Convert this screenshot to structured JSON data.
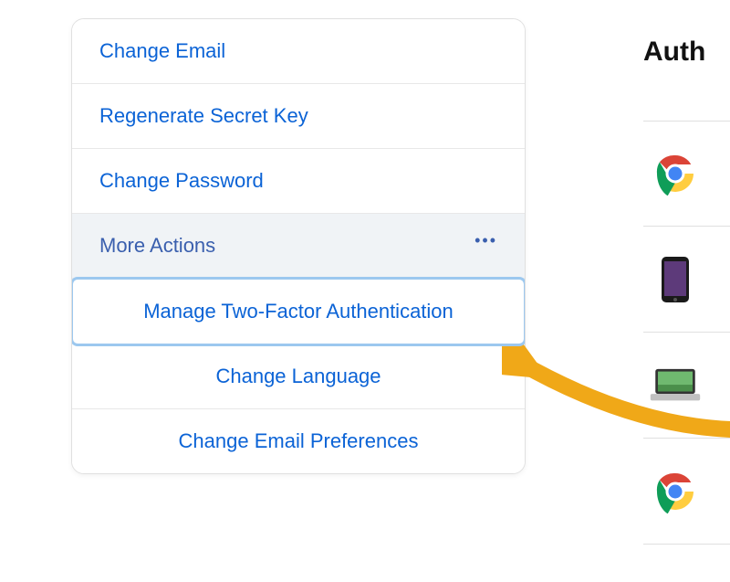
{
  "menu": {
    "items": [
      {
        "label": "Change Email"
      },
      {
        "label": "Regenerate Secret Key"
      },
      {
        "label": "Change Password"
      }
    ],
    "more_actions_label": "More Actions",
    "more_actions_glyph": "•••",
    "submenu": [
      {
        "label": "Manage Two-Factor Authentication",
        "highlighted": true
      },
      {
        "label": "Change Language"
      },
      {
        "label": "Change Email Preferences"
      }
    ]
  },
  "right_panel": {
    "title_visible": "Auth",
    "devices": [
      {
        "icon": "chrome-icon"
      },
      {
        "icon": "phone-icon"
      },
      {
        "icon": "laptop-icon"
      },
      {
        "icon": "chrome-icon"
      }
    ]
  },
  "colors": {
    "link": "#0b63d6",
    "highlight": "#9cc8ef",
    "arrow": "#f0a818"
  }
}
